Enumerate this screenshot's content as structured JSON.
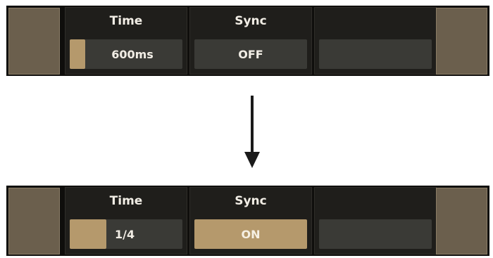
{
  "colors": {
    "accent": "#b5996c",
    "side_button": "#6b5f4d",
    "panel_bg": "#1f1e1b",
    "field_bg": "#3a3a36",
    "strip_bg": "#0f0e0c"
  },
  "before": {
    "time": {
      "label": "Time",
      "value": "600ms",
      "level": 0.15
    },
    "sync": {
      "label": "Sync",
      "value": "OFF"
    }
  },
  "after": {
    "time": {
      "label": "Time",
      "value": "1/4",
      "level": 0.33
    },
    "sync": {
      "label": "Sync",
      "value": "ON"
    }
  },
  "transition_icon": "arrow-down-icon"
}
